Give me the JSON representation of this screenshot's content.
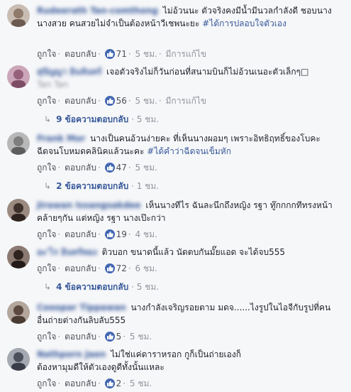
{
  "comments": [
    {
      "name": "Rudeerath Tan-comthong",
      "text": "ไม่อ้วนนะ ตัวจริงคงมีน้ำมีนวลกำลังดี ชอบนาง นางสวย คนสวยไม่จำเป็นต้องหน้าวีเชพนะยะ",
      "hashtag": "#ได้การปลอบใจตัวเอง",
      "like": "ถูกใจ",
      "reply": "ตอบกลับ",
      "likes": "71",
      "time": "5 ชม.",
      "edited": "มีการแก้ไข",
      "avatar_color": "#b7a79a"
    },
    {
      "name": "สุปัญญา อินจันทร์",
      "text": "เจอตัวจริงไม่ก็วันก่อนที่สนามบินก็ไม่อ้วนเนอะตัวเล็กๆ□",
      "tag": "Tan Tan",
      "like": "ถูกใจ",
      "reply": "ตอบกลับ",
      "likes": "56",
      "time": "5 ชม.",
      "edited": "มีการแก้ไข",
      "replies": "9 ข้อความตอบกลับ",
      "replies_time": "5 ชม.",
      "avatar_color": "#a66f8c"
    },
    {
      "name": "Frank Mor",
      "text": "นางเป็นคนอ้วนง่ายคะ ที่เห็นนางผอมๆ เพราะอิทธิฤทธิ์ของโบคะ ฉีดจนโบหมดคลินิคแล้วนะคะ",
      "hashtag": "#ได้คำว่าฉีดจนเข็มหัก",
      "like": "ถูกใจ",
      "reply": "ตอบกลับ",
      "likes": "47",
      "time": "5 ชม.",
      "replies": "2 ข้อความตอบกลับ",
      "replies_time": "1 ชม.",
      "avatar_color": "#8a8a8a"
    },
    {
      "name": "Jirawan Issangsakdee",
      "text": "เห็นนางทีไร ฉันละนึกถึงหญิง รฐา ทู๊กกกกทีทรงหน้าคล้ายๆกัน แต่หญิง รฐา นางเป๊ะกว่า",
      "like": "ถูกใจ",
      "reply": "ตอบกลับ",
      "likes": "19",
      "time": "4 ชม.",
      "avatar_color": "#5a4a42"
    },
    {
      "name": "อะ'ไร อินทร์ทอง",
      "text": "ติวบอก ขนาดนี้แล้ว นัดตบกันมั๊ยแอด จะได้จบ555",
      "like": "ถูกใจ",
      "reply": "ตอบกลับ",
      "likes": "72",
      "time": "6 ชม.",
      "replies": "4 ข้อความตอบกลับ",
      "replies_time": "5 ชม.",
      "avatar_color": "#4a3b36"
    },
    {
      "name": "Cooopar Tippawan",
      "text": "นางกำลังเจริญรอยตาม มดจ......ไงรูปในไอจีกับรูปที่คนอื่นถ่ายต่างกันลิบลับ555",
      "like": "ถูกใจ",
      "reply": "ตอบกลับ",
      "likes": "5",
      "time": "5 ชม.",
      "avatar_color": "#7a6a60"
    },
    {
      "name": "Nathporn Jaen",
      "text": "ไม่ใช่แค่ดาราหรอก กูก็เป็นถ่ายเองก็ต้องหามุมดีให้ตัวเองดูดีทั้งนั้นแหละ",
      "like": "ถูกใจ",
      "reply": "ตอบกลับ",
      "likes": "2",
      "time": "5 ชม.",
      "avatar_color": "#6b6f7a"
    }
  ],
  "colors": {
    "link": "#365899",
    "meta": "#90949c",
    "like_badge": "#4267b2",
    "background": "#f6f7f9"
  }
}
